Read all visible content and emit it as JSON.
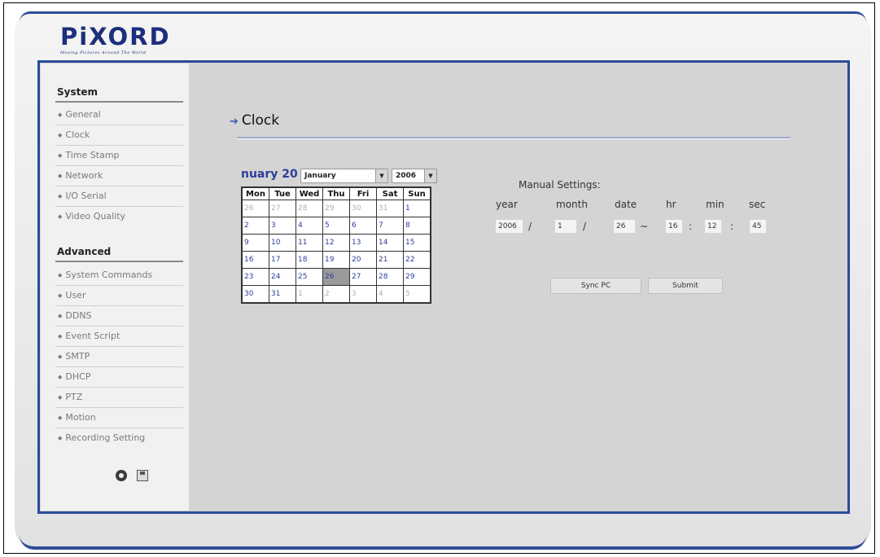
{
  "brand": {
    "logo_text": "PiXORD",
    "tagline": "Moving Pictures Around The World"
  },
  "sidebar": {
    "system_title": "System",
    "system_items": [
      "General",
      "Clock",
      "Time Stamp",
      "Network",
      "I/O Serial",
      "Video Quality"
    ],
    "advanced_title": "Advanced",
    "advanced_items": [
      "System Commands",
      "User",
      "DDNS",
      "Event Script",
      "SMTP",
      "DHCP",
      "PTZ",
      "Motion",
      "Recording Setting"
    ]
  },
  "page": {
    "title": "Clock"
  },
  "calendar": {
    "header_text": "nuary 20",
    "month_selected": "January",
    "year_selected": "2006",
    "day_headers": [
      "Mon",
      "Tue",
      "Wed",
      "Thu",
      "Fri",
      "Sat",
      "Sun"
    ],
    "weeks": [
      [
        "26",
        "27",
        "28",
        "29",
        "30",
        "31",
        "1"
      ],
      [
        "2",
        "3",
        "4",
        "5",
        "6",
        "7",
        "8"
      ],
      [
        "9",
        "10",
        "11",
        "12",
        "13",
        "14",
        "15"
      ],
      [
        "16",
        "17",
        "18",
        "19",
        "20",
        "21",
        "22"
      ],
      [
        "23",
        "24",
        "25",
        "26",
        "27",
        "28",
        "29"
      ],
      [
        "30",
        "31",
        "1",
        "2",
        "3",
        "4",
        "5"
      ]
    ],
    "selected_day": "26"
  },
  "manual": {
    "label": "Manual Settings:",
    "headers": {
      "year": "year",
      "month": "month",
      "date": "date",
      "hr": "hr",
      "min": "min",
      "sec": "sec"
    },
    "values": {
      "year": "2006",
      "month": "1",
      "date": "26",
      "hr": "16",
      "min": "12",
      "sec": "45"
    },
    "separators": {
      "date_sep": "/",
      "time_dash": "~",
      "time_sep": ":"
    }
  },
  "buttons": {
    "sync": "Sync PC",
    "submit": "Submit"
  },
  "colors": {
    "accent": "#2a4c98",
    "brand": "#1d2e7b",
    "calendar_text": "#2c3d99",
    "panel_bg": "#d4d4d4"
  }
}
